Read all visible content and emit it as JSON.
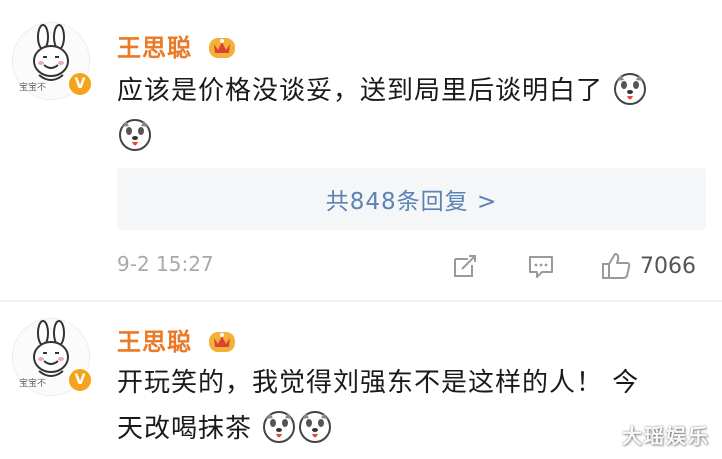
{
  "comments": [
    {
      "username": "王思聪",
      "text_line1": "应该是价格没谈妥，送到局里后谈明白了",
      "replies_label": "共848条回复 >",
      "timestamp": "9-2 15:27",
      "like_count": "7066",
      "avatar_caption": "宝宝不"
    },
    {
      "username": "王思聪",
      "text_line1": "开玩笑的，我觉得刘强东不是这样的人！ 今",
      "text_line2": "天改喝抹茶",
      "avatar_caption": "宝宝不"
    }
  ],
  "icons": {
    "verified": "verified-v-icon",
    "vip": "vip-crown-badge-icon",
    "emoji": "dog-face-emoji-icon",
    "repost": "repost-icon",
    "comment": "comment-icon",
    "like": "thumbs-up-icon"
  },
  "colors": {
    "username": "#ea7a25",
    "link": "#5b83b4",
    "verified": "#f6a21e",
    "meta": "#a9a9a9"
  },
  "watermark": "大瑶娱乐"
}
